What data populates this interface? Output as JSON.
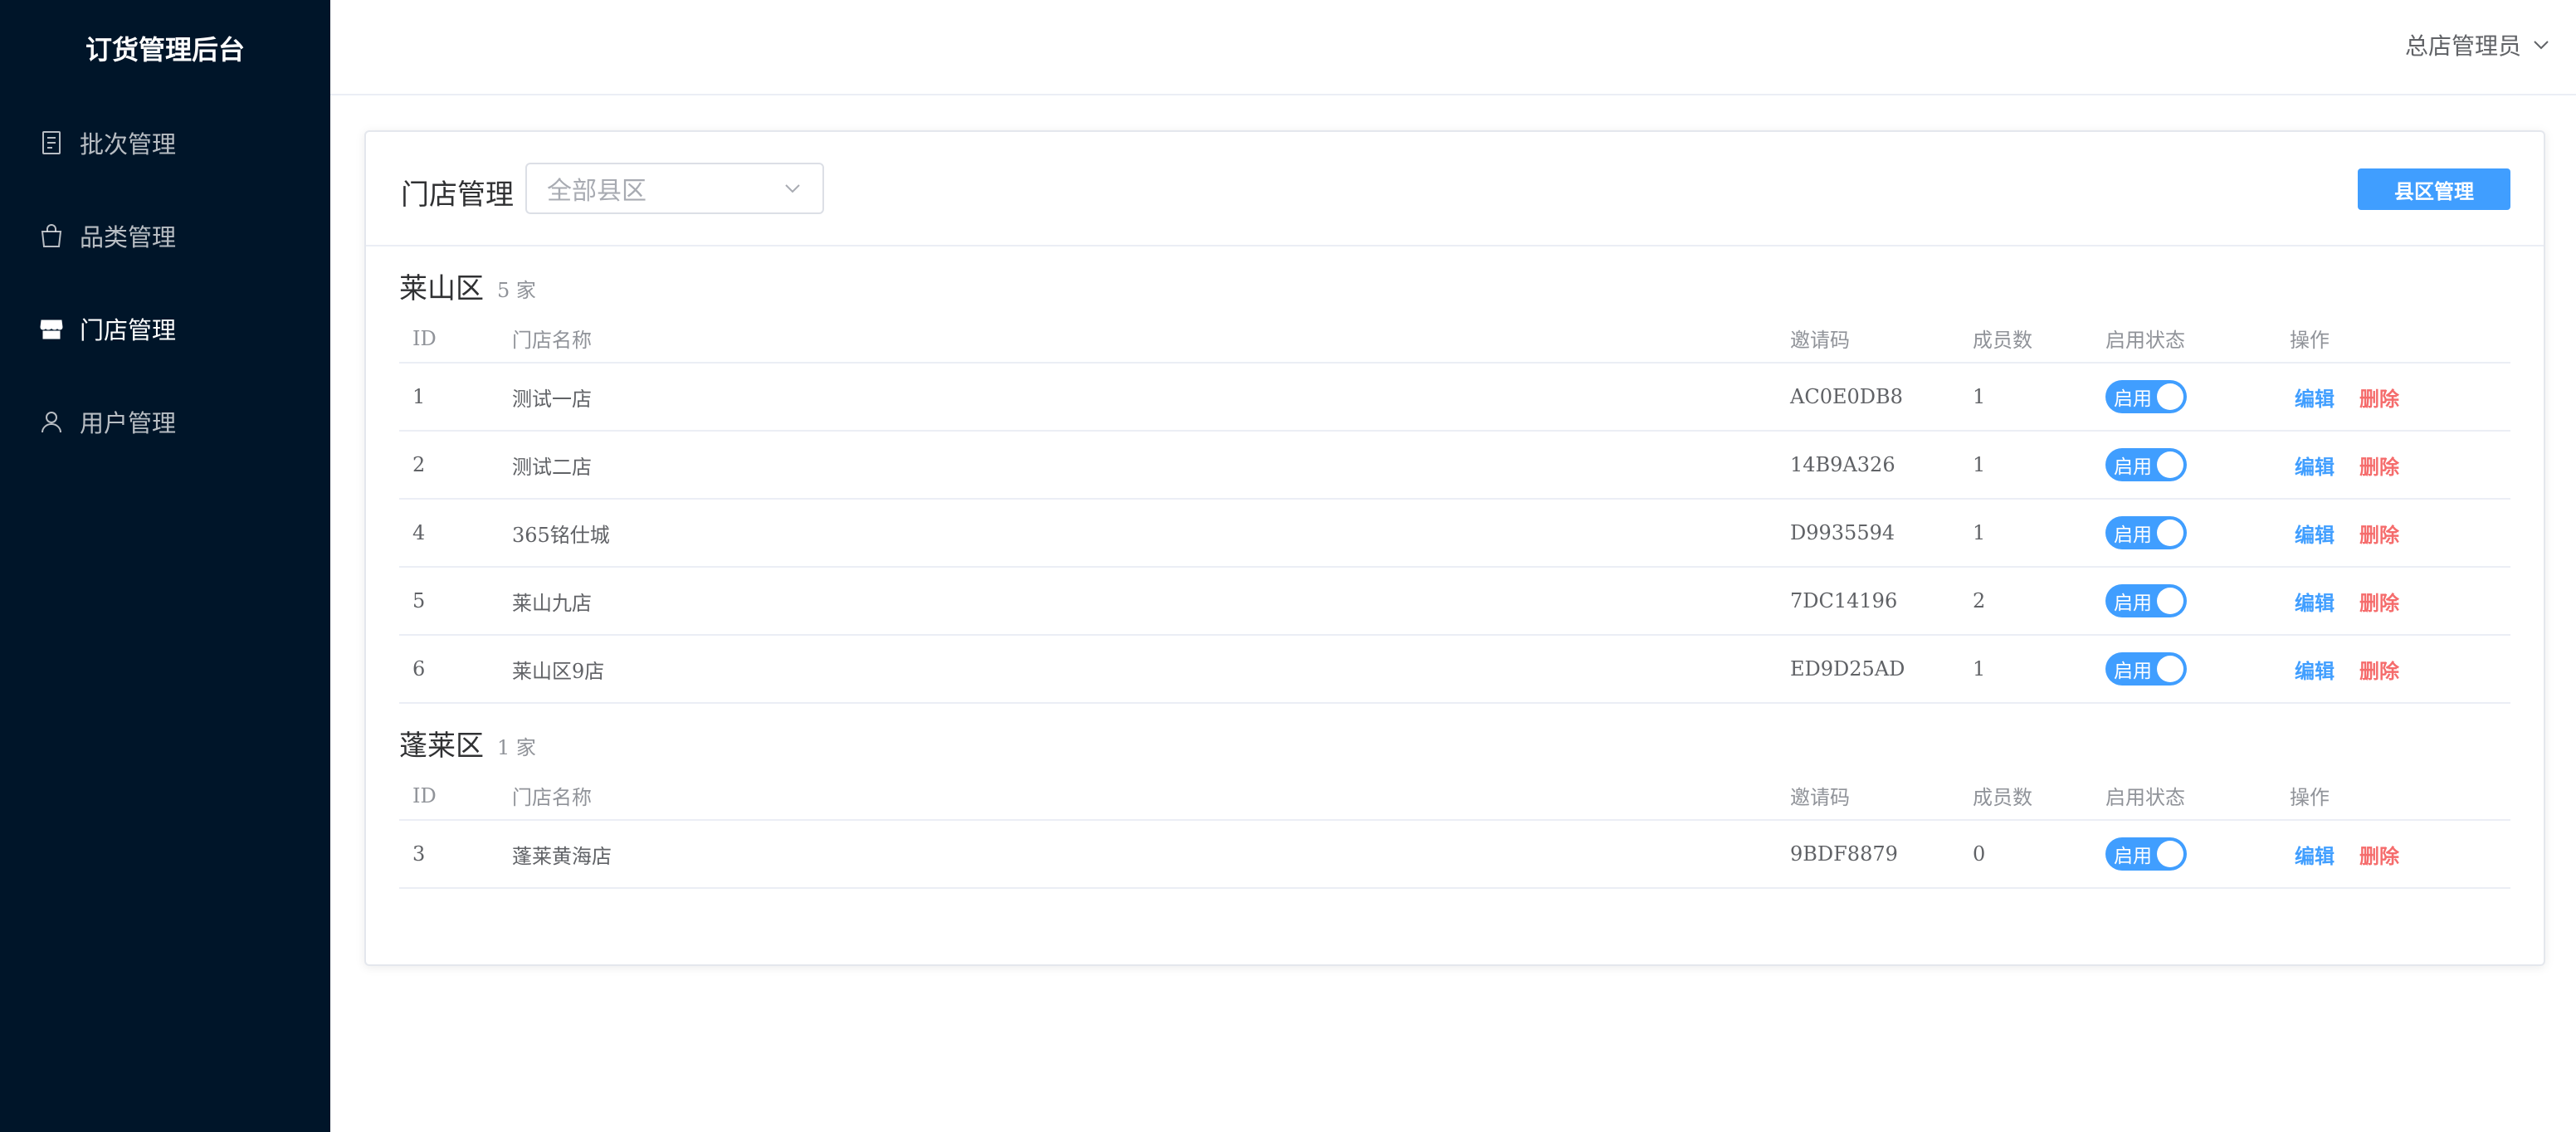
{
  "sidebar": {
    "brand": "订货管理后台",
    "items": [
      {
        "label": "批次管理",
        "icon": "document-icon",
        "active": false
      },
      {
        "label": "品类管理",
        "icon": "shopping-bag-icon",
        "active": false
      },
      {
        "label": "门店管理",
        "icon": "store-icon",
        "active": true
      },
      {
        "label": "用户管理",
        "icon": "user-icon",
        "active": false
      }
    ]
  },
  "header": {
    "user": "总店管理员"
  },
  "card": {
    "title": "门店管理",
    "select_placeholder": "全部县区",
    "action_button": "县区管理"
  },
  "columns": [
    "ID",
    "门店名称",
    "邀请码",
    "成员数",
    "启用状态",
    "操作"
  ],
  "labels": {
    "switch_on": "启用",
    "edit": "编辑",
    "delete": "删除"
  },
  "groups": [
    {
      "name": "莱山区",
      "count": "5 家",
      "rows": [
        {
          "id": "1",
          "name": "测试一店",
          "code": "AC0E0DB8",
          "members": "1"
        },
        {
          "id": "2",
          "name": "测试二店",
          "code": "14B9A326",
          "members": "1"
        },
        {
          "id": "4",
          "name": "365铭仕城",
          "code": "D9935594",
          "members": "1"
        },
        {
          "id": "5",
          "name": "莱山九店",
          "code": "7DC14196",
          "members": "2"
        },
        {
          "id": "6",
          "name": "莱山区9店",
          "code": "ED9D25AD",
          "members": "1"
        }
      ]
    },
    {
      "name": "蓬莱区",
      "count": "1 家",
      "rows": [
        {
          "id": "3",
          "name": "蓬莱黄海店",
          "code": "9BDF8879",
          "members": "0"
        }
      ]
    }
  ],
  "colors": {
    "sidebar_bg": "#001529",
    "primary": "#409eff",
    "danger": "#f56c6c"
  }
}
